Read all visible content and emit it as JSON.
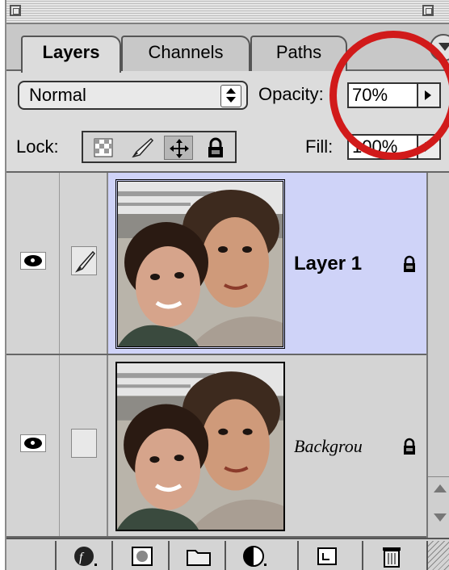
{
  "window": {
    "tabs": [
      {
        "label": "Layers",
        "active": true
      },
      {
        "label": "Channels",
        "active": false
      },
      {
        "label": "Paths",
        "active": false
      }
    ]
  },
  "blend": {
    "mode": "Normal",
    "opacity_label": "Opacity:",
    "opacity_value": "70%"
  },
  "lock": {
    "label": "Lock:",
    "fill_label": "Fill:",
    "fill_value": "100%"
  },
  "layers": [
    {
      "name": "Layer 1",
      "selected": true,
      "visible": true,
      "locked": true
    },
    {
      "name": "Backgrou",
      "selected": false,
      "visible": true,
      "locked": true
    }
  ],
  "colors": {
    "selected_layer": "#cfd3f8",
    "highlight_circle": "#d11a1a",
    "panel": "#dcdcdc"
  },
  "icons": {
    "bottom": [
      "layer-style-icon",
      "layer-mask-icon",
      "new-set-icon",
      "adjustment-layer-icon",
      "new-layer-icon",
      "trash-icon"
    ],
    "lock": [
      "lock-transparency-icon",
      "lock-brush-icon",
      "lock-move-icon",
      "lock-all-icon"
    ]
  }
}
